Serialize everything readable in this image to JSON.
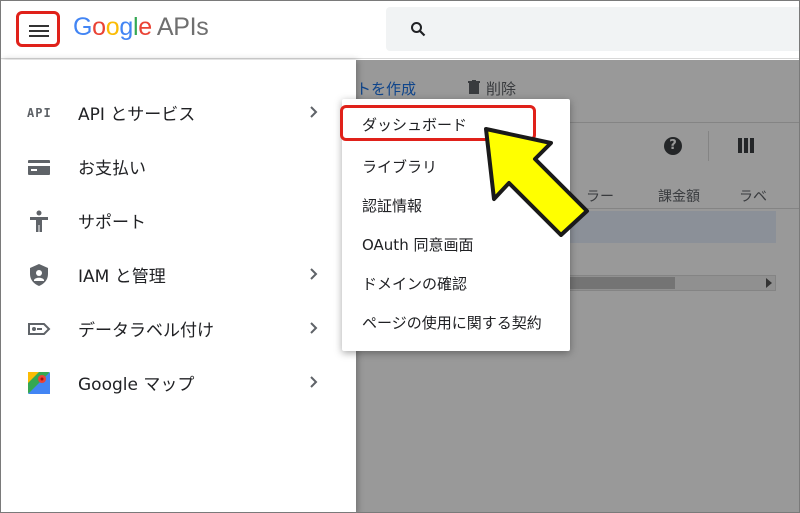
{
  "header": {
    "logo_google": [
      "G",
      "o",
      "o",
      "g",
      "l",
      "e"
    ],
    "logo_suffix": "APIs"
  },
  "background": {
    "toolbar_create": "トを作成",
    "toolbar_delete": "削除",
    "help": "?",
    "columns": [
      "ラー",
      "課金額",
      "ラベ"
    ]
  },
  "sidenav": {
    "items": [
      {
        "icon": "api-icon",
        "icon_text": "API",
        "label": "API とサービス",
        "has_submenu": true
      },
      {
        "icon": "billing-card-icon",
        "label": "お支払い",
        "has_submenu": false
      },
      {
        "icon": "support-person-icon",
        "label": "サポート",
        "has_submenu": false
      },
      {
        "icon": "iam-shield-icon",
        "label": "IAM と管理",
        "has_submenu": true
      },
      {
        "icon": "data-label-icon",
        "label": "データラベル付け",
        "has_submenu": true
      },
      {
        "icon": "google-maps-icon",
        "label": "Google マップ",
        "has_submenu": true
      }
    ]
  },
  "submenu": {
    "items": [
      {
        "label": "ダッシュボード",
        "highlighted": true
      },
      {
        "label": "ライブラリ"
      },
      {
        "label": "認証情報"
      },
      {
        "label": "OAuth 同意画面"
      },
      {
        "label": "ドメインの確認"
      },
      {
        "label": "ページの使用に関する契約"
      }
    ]
  },
  "colors": {
    "highlight_red": "#e0211a",
    "callout_yellow": "#ffff00",
    "google_blue": "#4285f4"
  }
}
